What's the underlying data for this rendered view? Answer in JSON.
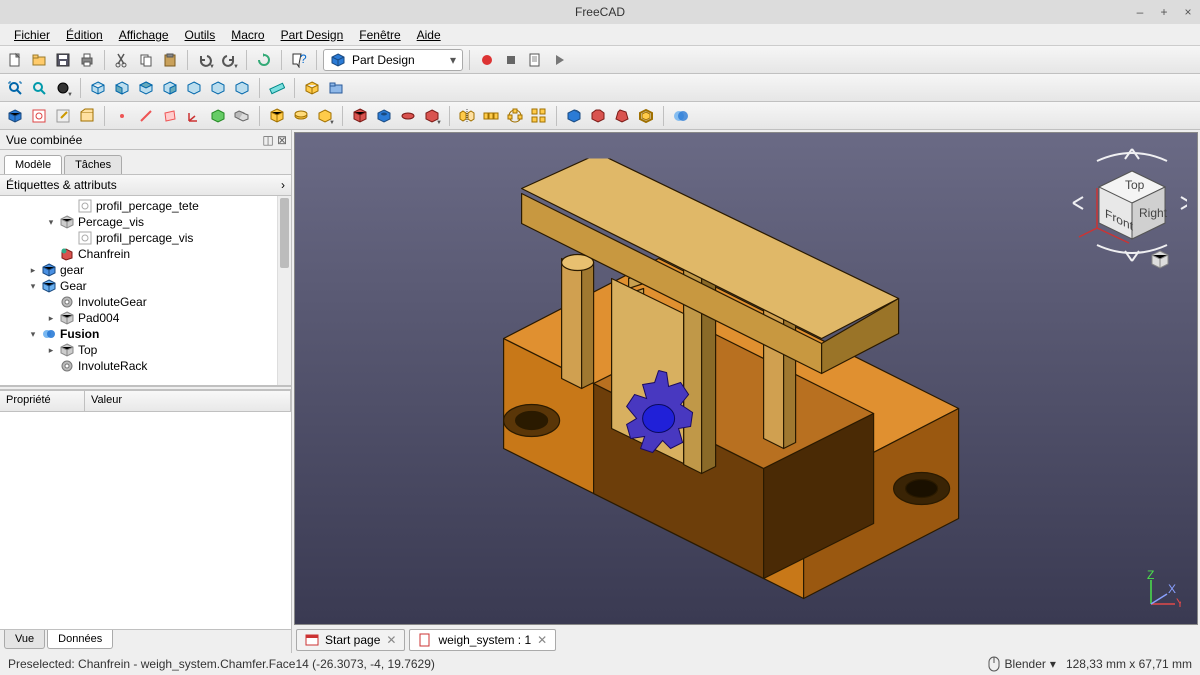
{
  "window": {
    "title": "FreeCAD"
  },
  "menu": {
    "items": [
      "Fichier",
      "Édition",
      "Affichage",
      "Outils",
      "Macro",
      "Part Design",
      "Fenêtre",
      "Aide"
    ]
  },
  "workbench": {
    "selected": "Part Design"
  },
  "panel": {
    "title": "Vue combinée",
    "tabs": {
      "model": "Modèle",
      "tasks": "Tâches",
      "active": "model"
    },
    "tree_header": "Étiquettes & attributs",
    "tree": [
      {
        "level": 3,
        "twisty": "",
        "icon": "sketch-grey",
        "label": "profil_percage_tete"
      },
      {
        "level": 2,
        "twisty": "▾",
        "icon": "cube-grey",
        "label": "Percage_vis"
      },
      {
        "level": 3,
        "twisty": "",
        "icon": "sketch-grey",
        "label": "profil_percage_vis"
      },
      {
        "level": 2,
        "twisty": "",
        "icon": "chamfer",
        "label": "Chanfrein"
      },
      {
        "level": 1,
        "twisty": "▸",
        "icon": "part-blue",
        "label": "gear"
      },
      {
        "level": 1,
        "twisty": "▾",
        "icon": "body-blue",
        "label": "Gear"
      },
      {
        "level": 2,
        "twisty": "",
        "icon": "gear-grey",
        "label": "InvoluteGear"
      },
      {
        "level": 2,
        "twisty": "▸",
        "icon": "pad-grey",
        "label": "Pad004"
      },
      {
        "level": 1,
        "twisty": "▾",
        "icon": "fusion-blue",
        "label": "Fusion",
        "bold": true
      },
      {
        "level": 2,
        "twisty": "▸",
        "icon": "pad-grey",
        "label": "Top"
      },
      {
        "level": 2,
        "twisty": "",
        "icon": "gear-grey",
        "label": "InvoluteRack"
      }
    ],
    "prop": {
      "col1": "Propriété",
      "col2": "Valeur"
    },
    "bottom_tabs": {
      "view": "Vue",
      "data": "Données",
      "active": "data"
    }
  },
  "docs": {
    "tabs": [
      {
        "icon": "start",
        "label": "Start page",
        "active": false
      },
      {
        "icon": "doc",
        "label": "weigh_system : 1",
        "active": true
      }
    ]
  },
  "navcube": {
    "top": "Top",
    "front": "Front",
    "right": "Right"
  },
  "status": {
    "text": "Preselected: Chanfrein - weigh_system.Chamfer.Face14 (-26.3073, -4, 19.7629)",
    "nav": "Blender",
    "dims": "128,33 mm x 67,71 mm"
  },
  "toolbars": {
    "row1_icons": [
      "new-doc",
      "open-doc",
      "save-doc",
      "print-doc",
      "sep",
      "cut",
      "copy",
      "paste",
      "sep",
      "undo-dd",
      "redo-dd",
      "sep",
      "refresh",
      "sep",
      "whatsthis"
    ],
    "row1_macro": [
      "record",
      "stop",
      "edit-macro",
      "play"
    ],
    "row2_icons": [
      "fit-all",
      "fit-sel",
      "draw-style-dd",
      "sep",
      "iso",
      "front-v",
      "top-v",
      "right-v",
      "rear-v",
      "bottom-v",
      "left-v",
      "sep",
      "measure",
      "sep",
      "part-y",
      "folder"
    ],
    "row3_a": [
      "body",
      "sketch",
      "edit-sk",
      "map-sk",
      "sep",
      "datum-pt",
      "datum-ln",
      "datum-pl",
      "datum-cs",
      "shapebinder",
      "clone",
      "sep"
    ],
    "row3_b": [
      "pad",
      "revolve",
      "loft-dd",
      "sep",
      "pocket",
      "hole",
      "groove",
      "sub-loft-dd",
      "sep",
      "mirror",
      "linear",
      "polar",
      "multi",
      "sep",
      "fillet",
      "chamfer",
      "draft",
      "thickness",
      "sep",
      "boolean"
    ]
  }
}
